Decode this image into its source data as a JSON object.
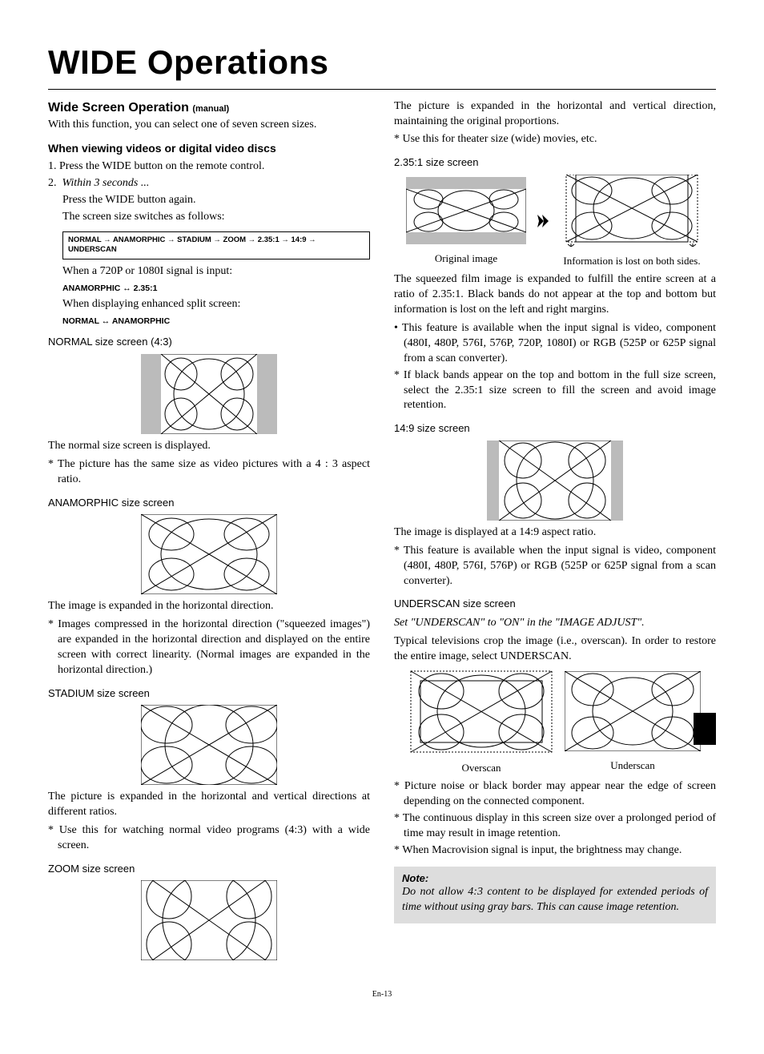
{
  "title": "WIDE Operations",
  "left": {
    "sec_title": "Wide Screen Operation",
    "sec_sub": "(manual)",
    "intro": "With this function, you can select one of seven screen sizes.",
    "sub1": "When viewing videos or digital video discs",
    "step1": "1.  Press the WIDE button on the remote control.",
    "step2_lead": "2.",
    "step2_italic": "Within 3 seconds ...",
    "step2a": "Press the WIDE button again.",
    "step2b": "The screen size switches as follows:",
    "chain": "NORMAL → ANAMORPHIC → STADIUM → ZOOM → 2.35:1 → 14:9 → UNDERSCAN",
    "when720": "When a 720P or 1080I signal is input:",
    "chain2": "ANAMORPHIC ↔ 2.35:1",
    "whenSplit": "When displaying enhanced split screen:",
    "chain3": "NORMAL ↔ ANAMORPHIC",
    "normal_head": "NORMAL size screen (4:3)",
    "normal_p1": "The normal size screen is displayed.",
    "normal_p2": "*  The picture has the same size as video pictures with a 4 : 3 aspect ratio.",
    "ana_head": "ANAMORPHIC size screen",
    "ana_p1": "The image is expanded in the horizontal direction.",
    "ana_p2": "*  Images compressed in the horizontal direction (\"squeezed images\") are expanded in the horizontal direction and displayed on the entire screen with correct linearity. (Normal images are expanded in the horizontal direction.)",
    "stad_head": "STADIUM size screen",
    "stad_p1": "The picture is expanded in the horizontal and vertical directions at different ratios.",
    "stad_p2": "*  Use this for watching normal video programs (4:3) with a wide screen.",
    "zoom_head": "ZOOM size screen"
  },
  "right": {
    "zoom_p1": "The picture is expanded in the horizontal and vertical direction, maintaining the original proportions.",
    "zoom_p2": "*  Use this for theater size (wide) movies, etc.",
    "r235_head": "2.35:1 size screen",
    "r235_cap1": "Original image",
    "r235_cap2": "Information is lost on both sides.",
    "r235_p1": "The squeezed film image is expanded to fulfill the entire screen at a ratio of 2.35:1. Black bands do not appear at the top and bottom but information is lost on the left and right margins.",
    "r235_b1": "•  This feature is available when the input signal is video, component (480I, 480P, 576I, 576P, 720P, 1080I) or RGB (525P or 625P signal from a scan converter).",
    "r235_b2": "*  If black bands appear on the top and bottom in the full size screen, select the 2.35:1 size screen to fill the screen and avoid image retention.",
    "r149_head": "14:9 size screen",
    "r149_p1": "The image is displayed at a 14:9 aspect ratio.",
    "r149_p2": "*  This feature is available when the input signal is video, component (480I, 480P, 576I, 576P) or RGB (525P or 625P signal from a scan converter).",
    "under_head": "UNDERSCAN size screen",
    "under_italic": "Set \"UNDERSCAN\" to \"ON\" in the \"IMAGE ADJUST\".",
    "under_p1": "Typical televisions crop the image (i.e., overscan). In order to restore the entire image, select UNDERSCAN.",
    "under_cap1": "Overscan",
    "under_cap2": "Underscan",
    "under_b1": "*  Picture noise or black border may appear near the edge of screen depending on the connected component.",
    "under_b2": "*  The continuous display in this screen size over a prolonged period of time may result in image retention.",
    "under_b3": "*  When Macrovision signal is input, the brightness may change.",
    "note_title": "Note:",
    "note_body": "Do not allow 4:3 content to be displayed for extended periods of time without using gray bars. This can cause image retention."
  },
  "footer": "En-13"
}
